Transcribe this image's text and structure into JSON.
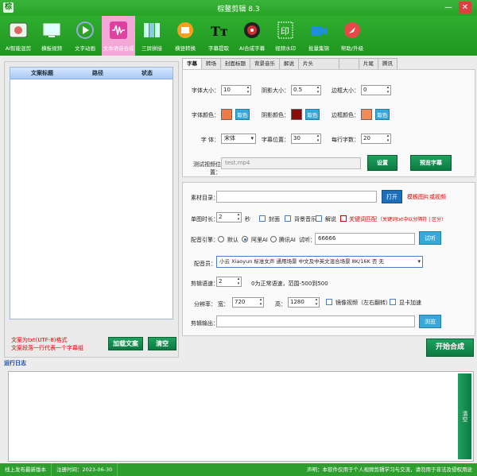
{
  "window": {
    "title": "棕鳌剪辑 8.3",
    "app_icon": "棕",
    "minimize": "—",
    "close": "✕"
  },
  "toolbar": [
    {
      "label": "AI智能混剪",
      "icon": "film-icon",
      "active": false
    },
    {
      "label": "横板视频",
      "icon": "monitor-icon",
      "active": false
    },
    {
      "label": "文字动画",
      "icon": "play-circle-icon",
      "active": false
    },
    {
      "label": "文本语音合成",
      "icon": "waveform-icon",
      "active": true
    },
    {
      "label": "三屏拼接",
      "icon": "split-icon",
      "active": false
    },
    {
      "label": "横竖转换",
      "icon": "rotate-icon",
      "active": false
    },
    {
      "label": "字幕提取",
      "icon": "text-icon",
      "active": false
    },
    {
      "label": "AI合成字幕",
      "icon": "target-icon",
      "active": false
    },
    {
      "label": "视频水印",
      "icon": "watermark-icon",
      "active": false
    },
    {
      "label": "批量集锦",
      "icon": "video-camera-icon",
      "active": false
    },
    {
      "label": "帮助/升级",
      "icon": "rocket-icon",
      "active": false
    }
  ],
  "list": {
    "headers": [
      "文案标题",
      "路径",
      "状态"
    ]
  },
  "note": {
    "line1": "文案为txt(UTF-8)格式",
    "line2": "文案段落一行代表一个字幕组"
  },
  "buttons": {
    "load": "加载文案",
    "clear": "清空",
    "start": "开始合成",
    "log_clear": "清空"
  },
  "tabs": [
    "字幕",
    "转场",
    "封面标题",
    "背景音乐",
    "解说",
    "片头",
    "",
    "",
    "",
    "",
    "",
    "",
    "",
    "",
    "片尾",
    "",
    "",
    "",
    "",
    "",
    "",
    "",
    "",
    "",
    "",
    "",
    "",
    "",
    "",
    "",
    "",
    "",
    "",
    "",
    "",
    "",
    "",
    "",
    "",
    "",
    "",
    ""
  ],
  "tab_labels": [
    "字幕",
    "转场",
    "封面标题",
    "背景音乐",
    "解说",
    "片头",
    "",
    "",
    "",
    "",
    "",
    "片尾",
    "",
    "",
    "",
    "",
    "",
    "",
    "",
    "",
    "",
    "",
    "",
    "",
    "",
    "",
    "",
    "",
    "",
    "",
    "",
    "",
    "",
    "",
    "",
    "",
    "",
    "",
    "",
    "",
    "",
    "",
    "",
    "",
    "",
    "",
    "",
    ""
  ],
  "tab_visible": [
    "字幕",
    "转场",
    "封面标题",
    "背景音乐",
    "解说",
    "片头",
    "",
    "片尾",
    "",
    "",
    "",
    ""
  ],
  "tab_set": [
    "字幕",
    "转场",
    "封面标题",
    "背景音乐",
    "解说",
    "片头",
    "",
    "片尾",
    "",
    "",
    ""
  ],
  "tabs_final": [
    "字幕",
    "转场",
    "封面标题",
    "背景音乐",
    "解说",
    "片头",
    "片尾",
    "腾讯"
  ],
  "subtitle": {
    "font_size_label": "字体大小：",
    "font_size": "10",
    "shadow_size_label": "阴影大小：",
    "shadow_size": "0.5",
    "border_size_label": "边框大小：",
    "border_size": "0",
    "font_color_label": "字体颜色：",
    "font_color": "#f07a46",
    "shadow_color_label": "阴影颜色：",
    "shadow_color": "#8b0c0c",
    "border_color_label": "边框颜色：",
    "border_color": "#f28a5a",
    "color_btn": "取色",
    "font_label": "字    体：",
    "font": "宋体",
    "position_label": "字幕位置：",
    "position": "30",
    "chars_label": "每行字数：",
    "chars": "20",
    "test_video_label": "测试视频位置：",
    "test_video": "test.mp4",
    "settings_btn": "设置",
    "preview_btn": "预览字幕"
  },
  "material": {
    "dir_label": "素材目录：",
    "dir_value": "",
    "open_btn": "打开",
    "template_hint": "模板图片或视频",
    "duration_label": "单图时长：",
    "duration": "2",
    "duration_unit": "秒",
    "cover_label": "封面",
    "bgm_label": "背景音乐",
    "narration_label": "解说",
    "keyword_label": "关键词匹配",
    "keyword_hint": "（关键词txt中以分隔符 | 区分）",
    "engine_label": "配音引擎：",
    "engine_default": "默认",
    "engine_ali": "阿里AI",
    "engine_tencent": "腾讯AI",
    "trial_label": "试听：",
    "trial_text": "66666",
    "trial_btn": "试听",
    "voice_label": "配音员：",
    "voice_value": "小云 Xiaoyun 标准女声 通用场景 中文及中英文混合场景 8K/16K 否 无",
    "speed_label": "剪辑语速：",
    "speed": "2",
    "speed_hint": "0为正常语速，范围-500到500",
    "res_label": "分辨率：",
    "width_label": "宽：",
    "width": "720",
    "height_label": "高：",
    "height": "1280",
    "mirror_label": "镜像视频（左右翻转）",
    "gpu_label": "显卡加速",
    "output_label": "剪辑输出：",
    "output_value": "",
    "browse_btn": "浏览"
  },
  "log": {
    "title": "运行日志"
  },
  "status": {
    "left1": "线上发布最新版本",
    "left2": "注册时间：2023-06-30",
    "right": "声明：本软件仅用于个人视频剪辑学习与交流，请勿用于非法及侵权用途"
  },
  "colors": {
    "green": "#27a327",
    "active_tab": "#f3a8d8",
    "btn_green": "#0c7a42",
    "btn_blue": "#38a8d8"
  }
}
